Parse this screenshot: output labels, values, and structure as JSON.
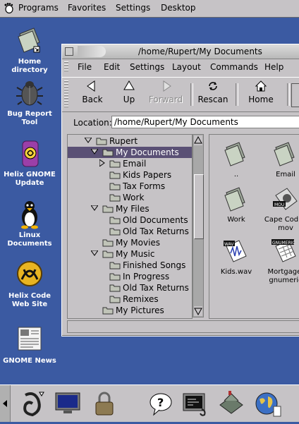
{
  "top_panel": {
    "menus": [
      "Programs",
      "Favorites",
      "Settings",
      "Desktop"
    ]
  },
  "desktop_icons": [
    {
      "label": "Home directory",
      "icon": "home-folder-icon"
    },
    {
      "label": "Bug Report Tool",
      "icon": "bug-icon"
    },
    {
      "label": "Helix GNOME Update",
      "icon": "helix-update-icon"
    },
    {
      "label": "Linux Documents",
      "icon": "penguin-icon"
    },
    {
      "label": "Helix Code Web Site",
      "icon": "helix-logo-icon"
    },
    {
      "label": "GNOME News",
      "icon": "newspaper-icon"
    }
  ],
  "window": {
    "title": "/home/Rupert/My Documents",
    "menus": [
      "File",
      "Edit",
      "Settings",
      "Layout",
      "Commands",
      "Help"
    ],
    "toolbar": {
      "back": "Back",
      "up": "Up",
      "forward": "Forward",
      "rescan": "Rescan",
      "home": "Home"
    },
    "location": {
      "label": "Location:",
      "value": "/home/Rupert/My Documents"
    },
    "tree": [
      {
        "label": "Rupert",
        "level": 0,
        "expanded": true
      },
      {
        "label": "My Documents",
        "level": 1,
        "expanded": true,
        "selected": true
      },
      {
        "label": "Email",
        "level": 2,
        "collapsed": true
      },
      {
        "label": "Kids Papers",
        "level": 2
      },
      {
        "label": "Tax Forms",
        "level": 2
      },
      {
        "label": "Work",
        "level": 2
      },
      {
        "label": "My Files",
        "level": 1,
        "expanded": true
      },
      {
        "label": "Old Documents",
        "level": 2
      },
      {
        "label": "Old Tax Returns",
        "level": 2
      },
      {
        "label": "My Movies",
        "level": 1
      },
      {
        "label": "My Music",
        "level": 1,
        "expanded": true
      },
      {
        "label": "Finished Songs",
        "level": 2
      },
      {
        "label": "In Progress",
        "level": 2
      },
      {
        "label": "Old Tax Returns",
        "level": 2
      },
      {
        "label": "Remixes",
        "level": 2
      },
      {
        "label": "My Pictures",
        "level": 1
      }
    ],
    "files": [
      {
        "name": "..",
        "icon": "folder-icon"
      },
      {
        "name": "Email",
        "icon": "folder-icon"
      },
      {
        "name": "Work",
        "icon": "folder-icon"
      },
      {
        "name": "Cape Cod Tr... mov",
        "line1": "Cape Cod Tr",
        "line2": "mov",
        "icon": "movie-file-icon",
        "badge": "MOU"
      },
      {
        "name": "Kids.wav",
        "icon": "audio-file-icon",
        "badge": "WAV"
      },
      {
        "name": "Mortgage. gnumeric",
        "line1": "Mortgage.",
        "line2": "gnumeric",
        "icon": "spreadsheet-file-icon",
        "badge": "GNUMERIC"
      }
    ]
  },
  "bottom_panel": {
    "launchers": [
      "gnome-foot-icon",
      "monitor-icon",
      "padlock-icon",
      "help-icon",
      "terminal-icon",
      "file-manager-icon",
      "web-browser-icon"
    ]
  }
}
